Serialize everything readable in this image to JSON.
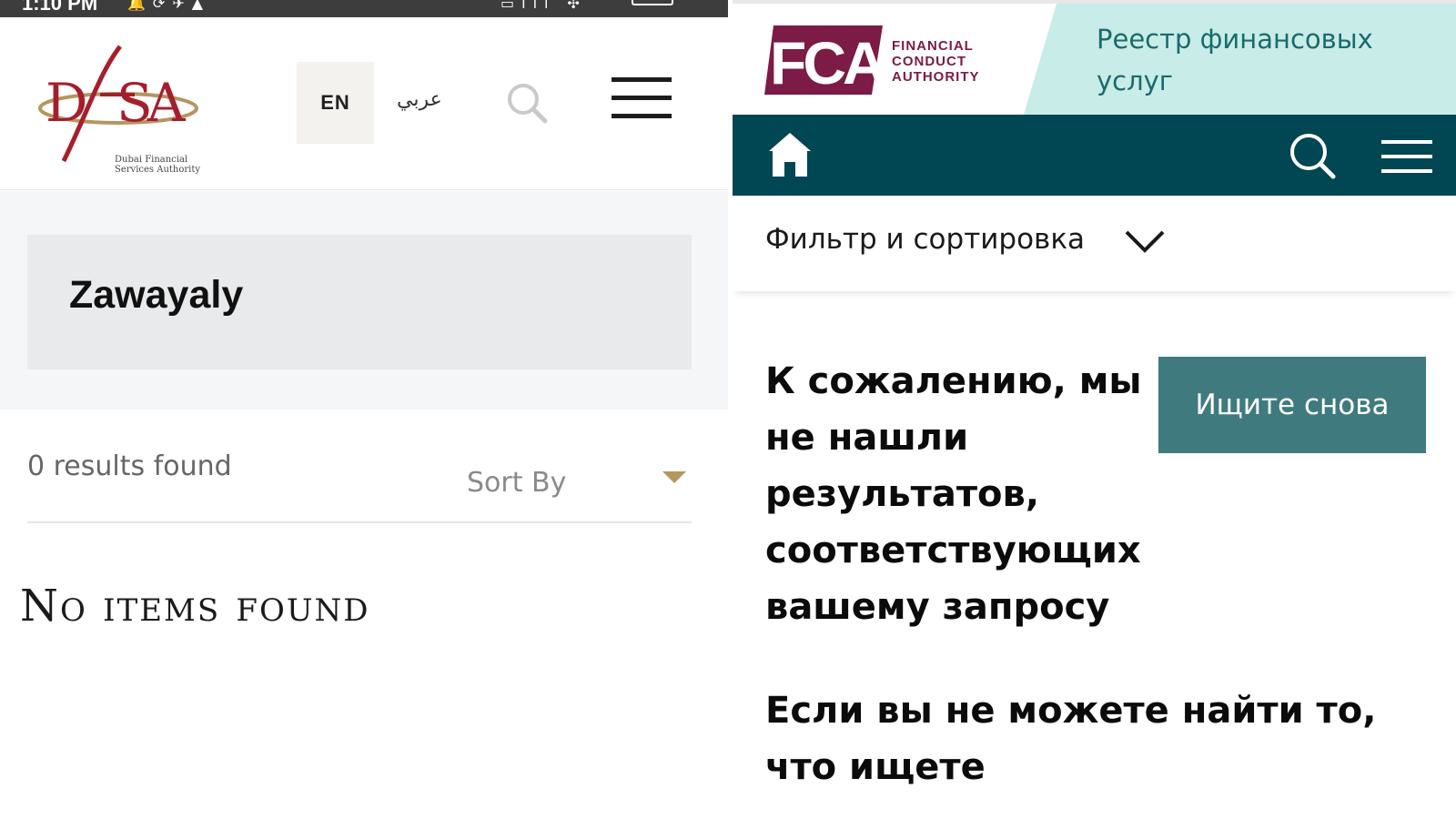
{
  "left_panel": {
    "status_bar": {
      "time": "1:10 PM"
    },
    "header": {
      "logo_text": "DFSA",
      "logo_subtitle": "Dubai Financial\nServices Authority",
      "lang_en": "EN",
      "lang_ar": "عربي"
    },
    "search": {
      "query": "Zawayaly"
    },
    "results": {
      "count_text": "0 results found",
      "sort_label": "Sort By",
      "empty_message": "No items found"
    }
  },
  "right_panel": {
    "header": {
      "logo_text": "FCA",
      "logo_subtitle": "FINANCIAL\nCONDUCT\nAUTHORITY",
      "register_title": "Реестр финансовых услуг"
    },
    "filter": {
      "label": "Фильтр и сортировка"
    },
    "no_results": {
      "message": "К сожалению, мы не нашли результатов, соответствующих вашему запросу",
      "retry_button": "Ищите снова",
      "hint": "Если вы не можете найти то, что ищете"
    }
  },
  "colors": {
    "dfsa_red": "#a61e2c",
    "dfsa_gold": "#b49660",
    "fca_maroon": "#7b1b46",
    "fca_teal_dark": "#004653",
    "fca_teal_button": "#3f7a7e",
    "fca_mint": "#c8ece8"
  },
  "icons": [
    "wifi-icon",
    "signal-icon",
    "battery-icon",
    "search-icon",
    "hamburger-menu-icon",
    "home-icon",
    "chevron-down-icon",
    "caret-down-icon"
  ]
}
